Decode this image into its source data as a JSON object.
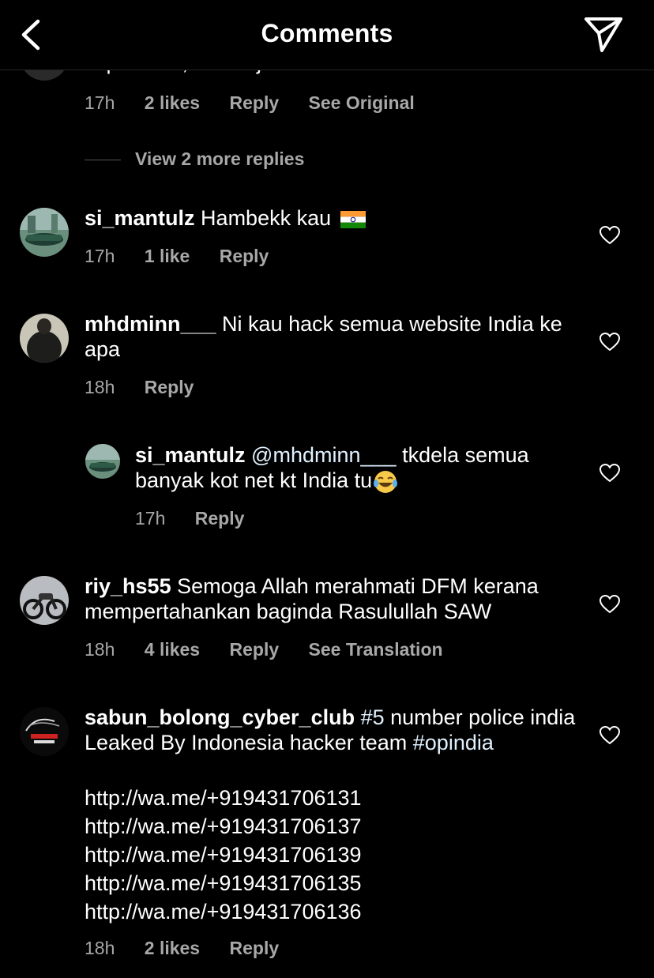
{
  "header": {
    "title": "Comments"
  },
  "cutoff_comment": {
    "text_fragment": "impressed, or is it just me who doesn't know",
    "meta": {
      "time": "17h",
      "likes": "2 likes",
      "reply": "Reply",
      "extra": "See Original"
    }
  },
  "view_more": "View 2 more replies",
  "comments": [
    {
      "username": "si_mantulz",
      "text": " Hambekk kau",
      "meta": {
        "time": "17h",
        "likes": "1 like",
        "reply": "Reply"
      }
    },
    {
      "username": "mhdminn___",
      "text": " Ni kau hack semua website India ke apa",
      "meta": {
        "time": "18h",
        "reply": "Reply"
      }
    },
    {
      "username": "si_mantulz",
      "mention": " @mhdminn___",
      "text": " tkdela semua banyak kot net kt India tu",
      "meta": {
        "time": "17h",
        "reply": "Reply"
      }
    },
    {
      "username": "riy_hs55",
      "text": " Semoga Allah merahmati DFM kerana mempertahankan baginda Rasulullah SAW",
      "meta": {
        "time": "18h",
        "likes": "4 likes",
        "reply": "Reply",
        "extra": "See Translation"
      }
    },
    {
      "username": "sabun_bolong_cyber_club",
      "hashtag1": " #5",
      "text": " number police india Leaked By Indonesia hacker team ",
      "hashtag2": "#opindia",
      "links": [
        "http://wa.me/+919431706131",
        "http://wa.me/+919431706137",
        "http://wa.me/+919431706139",
        "http://wa.me/+919431706135",
        "http://wa.me/+919431706136"
      ],
      "meta": {
        "time": "18h",
        "likes": "2 likes",
        "reply": "Reply"
      }
    }
  ],
  "icons": {
    "back": "chevron-left-icon",
    "send": "send-icon",
    "heart": "heart-icon",
    "flag": "india-flag-emoji",
    "laugh": "tears-of-joy-emoji"
  },
  "colors": {
    "background": "#000000",
    "text": "#ffffff",
    "secondary": "#a8a8a8",
    "hashtag": "#e0f1ff"
  }
}
